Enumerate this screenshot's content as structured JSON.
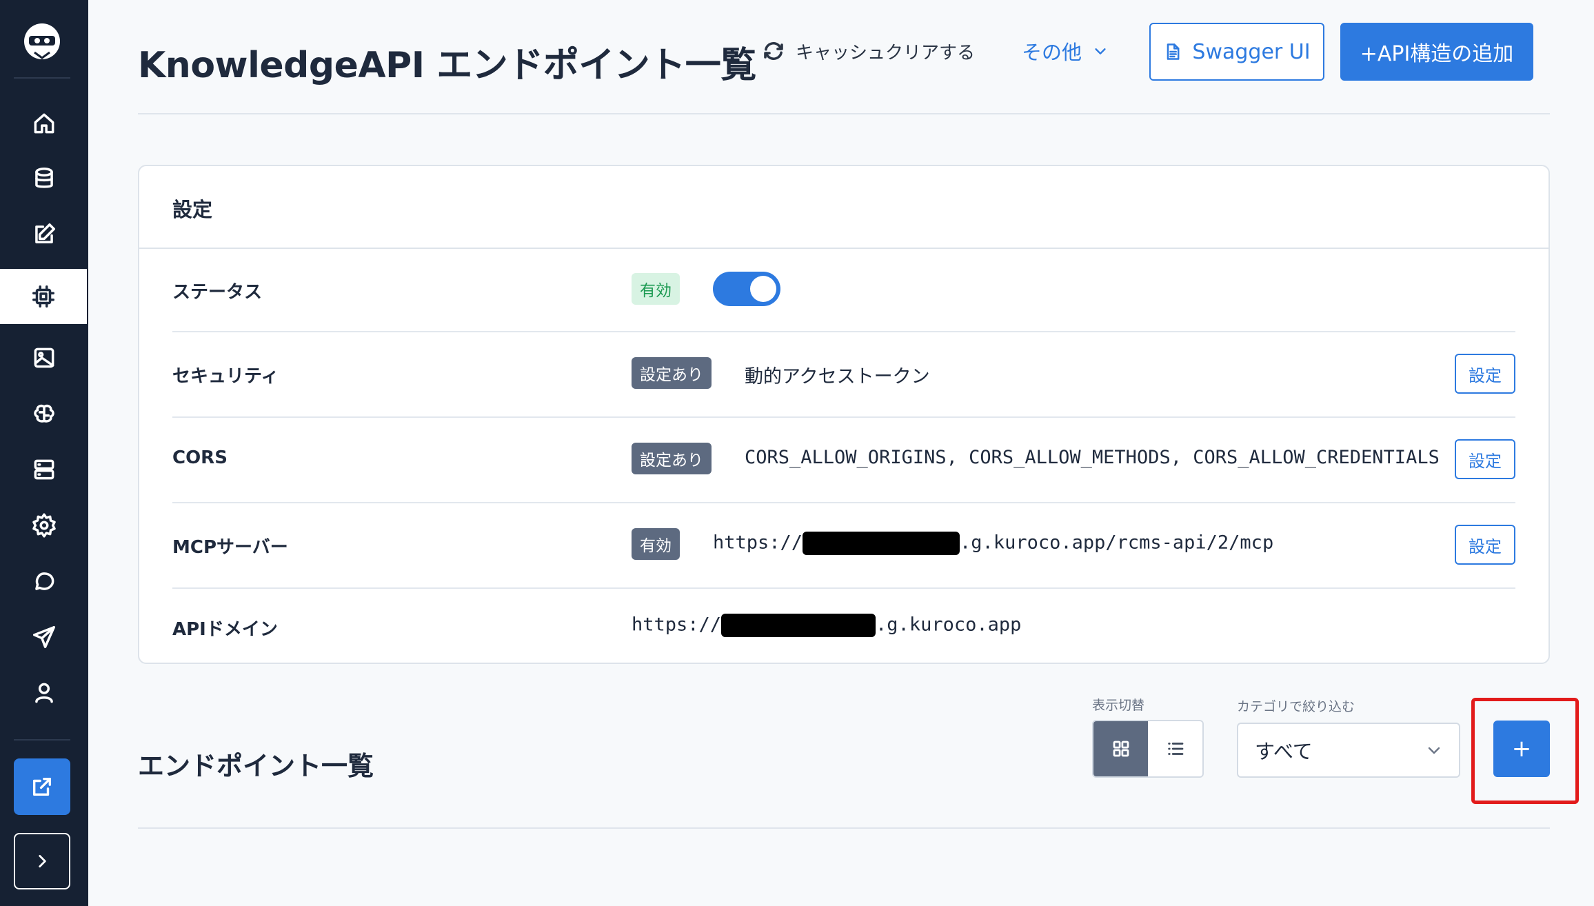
{
  "header": {
    "title": "KnowledgeAPI エンドポイント一覧",
    "cache_clear_label": "キャッシュクリアする",
    "other_label": "その他",
    "swagger_label": "Swagger UI",
    "add_structure_label": "+API構造の追加"
  },
  "sidebar": {
    "items": [
      {
        "name": "home-icon",
        "active": false
      },
      {
        "name": "database-icon",
        "active": false
      },
      {
        "name": "edit-icon",
        "active": false
      },
      {
        "name": "chip-icon",
        "active": true
      },
      {
        "name": "image-icon",
        "active": false
      },
      {
        "name": "brain-icon",
        "active": false
      },
      {
        "name": "server-icon",
        "active": false
      },
      {
        "name": "gear-icon",
        "active": false
      },
      {
        "name": "chat-icon",
        "active": false
      },
      {
        "name": "send-icon",
        "active": false
      },
      {
        "name": "user-icon",
        "active": false
      }
    ],
    "external_icon": "external-link-icon",
    "expand_icon": "chevron-right-icon"
  },
  "settings": {
    "title": "設定",
    "status": {
      "label": "ステータス",
      "badge": "有効",
      "enabled": true
    },
    "security": {
      "label": "セキュリティ",
      "badge": "設定あり",
      "value": "動的アクセストークン",
      "button": "設定"
    },
    "cors": {
      "label": "CORS",
      "badge": "設定あり",
      "value": "CORS_ALLOW_ORIGINS, CORS_ALLOW_METHODS, CORS_ALLOW_CREDENTIALS",
      "button": "設定"
    },
    "mcp": {
      "label": "MCPサーバー",
      "badge": "有効",
      "url_prefix": "https://",
      "url_suffix": ".g.kuroco.app/rcms-api/2/mcp",
      "button": "設定"
    },
    "api_domain": {
      "label": "APIドメイン",
      "url_prefix": "https://",
      "url_suffix": ".g.kuroco.app"
    }
  },
  "endpoints": {
    "title": "エンドポイント一覧",
    "view_toggle_label": "表示切替",
    "category_label": "カテゴリで絞り込む",
    "category_value": "すべて",
    "add_label": "+"
  },
  "colors": {
    "sidebar_bg": "#162133",
    "accent": "#2d7ae0",
    "highlight": "#e21b1b"
  }
}
